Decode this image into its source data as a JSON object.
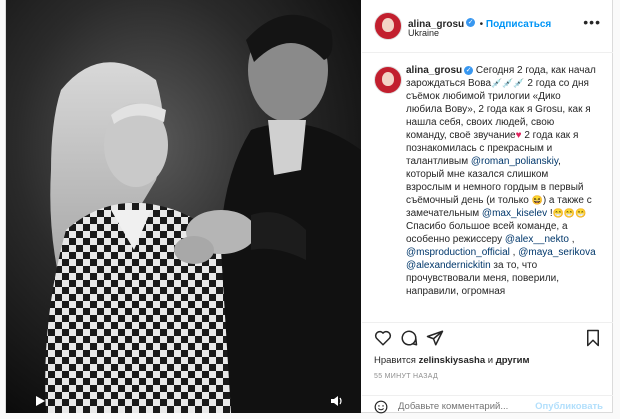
{
  "post": {
    "username": "alina_grosu",
    "verified_mark": "✓",
    "follow_label": "Подписаться",
    "location": "Ukraine",
    "more_icon": "more-horizontal-icon"
  },
  "caption": {
    "username": "alina_grosu",
    "line1": "Сегодня 2 года, как начал зарождаться Вова",
    "line2": "2 года со дня съёмок любимой трилогии «Дико любила Вову», 2 года как я Grosu, как я нашла себя, своих людей, свою команду, своё звучание",
    "line3": "2 года как я познакомилась с прекрасным и талантливым",
    "mention1": "@roman_polianskiy",
    "line4": ", который мне казался слишком взрослым и немного гордым в первый съёмочный день (и только",
    "line5": ") а также с замечательным",
    "mention2": "@max_kiselev",
    "line6": "Спасибо большое всей команде, а особенно режиссеру",
    "mention3": "@alex__nekto",
    "mention4": "@msproduction_official",
    "mention5": "@maya_serikova",
    "mention6": "@alexandernickitin",
    "line7": "за то, что прочувствовали меня, поверили, направили, огромная"
  },
  "engagement": {
    "liked_prefix": "Нравится",
    "liked_user": "zelinskiysasha",
    "liked_and": "и",
    "liked_others": "другим",
    "timestamp": "55 МИНУТ НАЗАД"
  },
  "comment": {
    "placeholder": "Добавьте комментарий...",
    "post_label": "Опубликовать"
  },
  "colors": {
    "accent": "#0095f6",
    "mention": "#00376b",
    "heart": "#e0245e",
    "post_disabled": "#b2dffc"
  }
}
